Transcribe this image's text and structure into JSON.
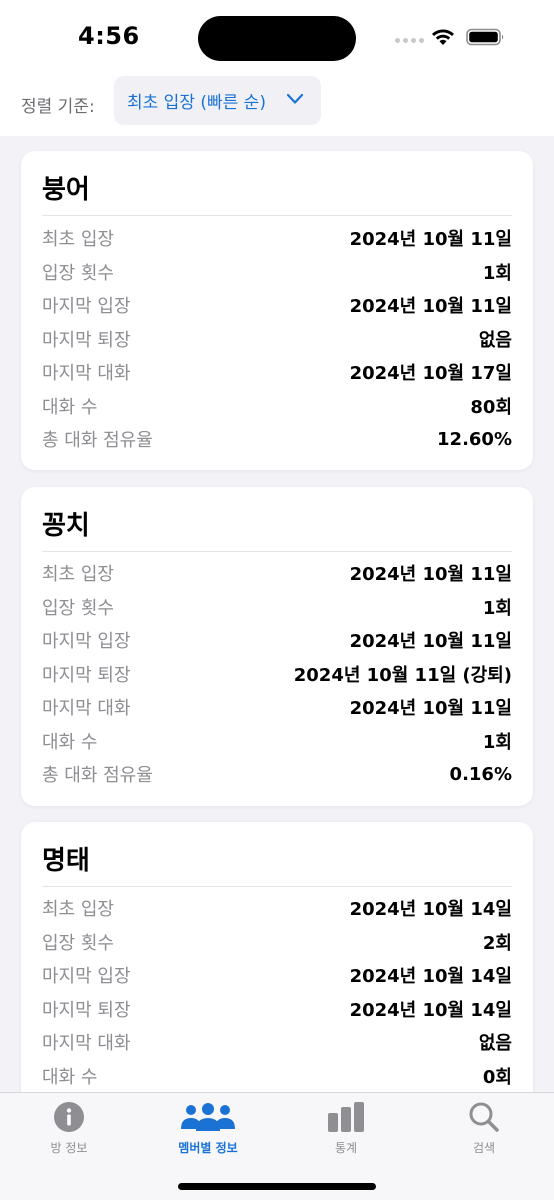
{
  "status": {
    "time": "4:56"
  },
  "sort": {
    "label": "정렬 기준:",
    "value": "최초 입장 (빠른 순)"
  },
  "members": [
    {
      "name": "붕어",
      "rows": [
        {
          "k": "최초 입장",
          "v": "2024년 10월 11일"
        },
        {
          "k": "입장 횟수",
          "v": "1회"
        },
        {
          "k": "마지막 입장",
          "v": "2024년 10월 11일"
        },
        {
          "k": "마지막 퇴장",
          "v": "없음"
        },
        {
          "k": "마지막 대화",
          "v": "2024년 10월 17일"
        },
        {
          "k": "대화 수",
          "v": "80회"
        },
        {
          "k": "총 대화 점유율",
          "v": "12.60%"
        }
      ]
    },
    {
      "name": "꽁치",
      "rows": [
        {
          "k": "최초 입장",
          "v": "2024년 10월 11일"
        },
        {
          "k": "입장 횟수",
          "v": "1회"
        },
        {
          "k": "마지막 입장",
          "v": "2024년 10월 11일"
        },
        {
          "k": "마지막 퇴장",
          "v": "2024년 10월 11일 (강퇴)"
        },
        {
          "k": "마지막 대화",
          "v": "2024년 10월 11일"
        },
        {
          "k": "대화 수",
          "v": "1회"
        },
        {
          "k": "총 대화 점유율",
          "v": "0.16%"
        }
      ]
    },
    {
      "name": "명태",
      "rows": [
        {
          "k": "최초 입장",
          "v": "2024년 10월 14일"
        },
        {
          "k": "입장 횟수",
          "v": "2회"
        },
        {
          "k": "마지막 입장",
          "v": "2024년 10월 14일"
        },
        {
          "k": "마지막 퇴장",
          "v": "2024년 10월 14일"
        },
        {
          "k": "마지막 대화",
          "v": "없음"
        },
        {
          "k": "대화 수",
          "v": "0회"
        }
      ]
    }
  ],
  "tabs": [
    {
      "label": "방 정보",
      "icon": "info-icon"
    },
    {
      "label": "멤버별 정보",
      "icon": "people-icon"
    },
    {
      "label": "통계",
      "icon": "bar-chart-icon"
    },
    {
      "label": "검색",
      "icon": "search-icon"
    }
  ],
  "colors": {
    "accent": "#1a73d4",
    "inactive": "#8e8e93"
  }
}
